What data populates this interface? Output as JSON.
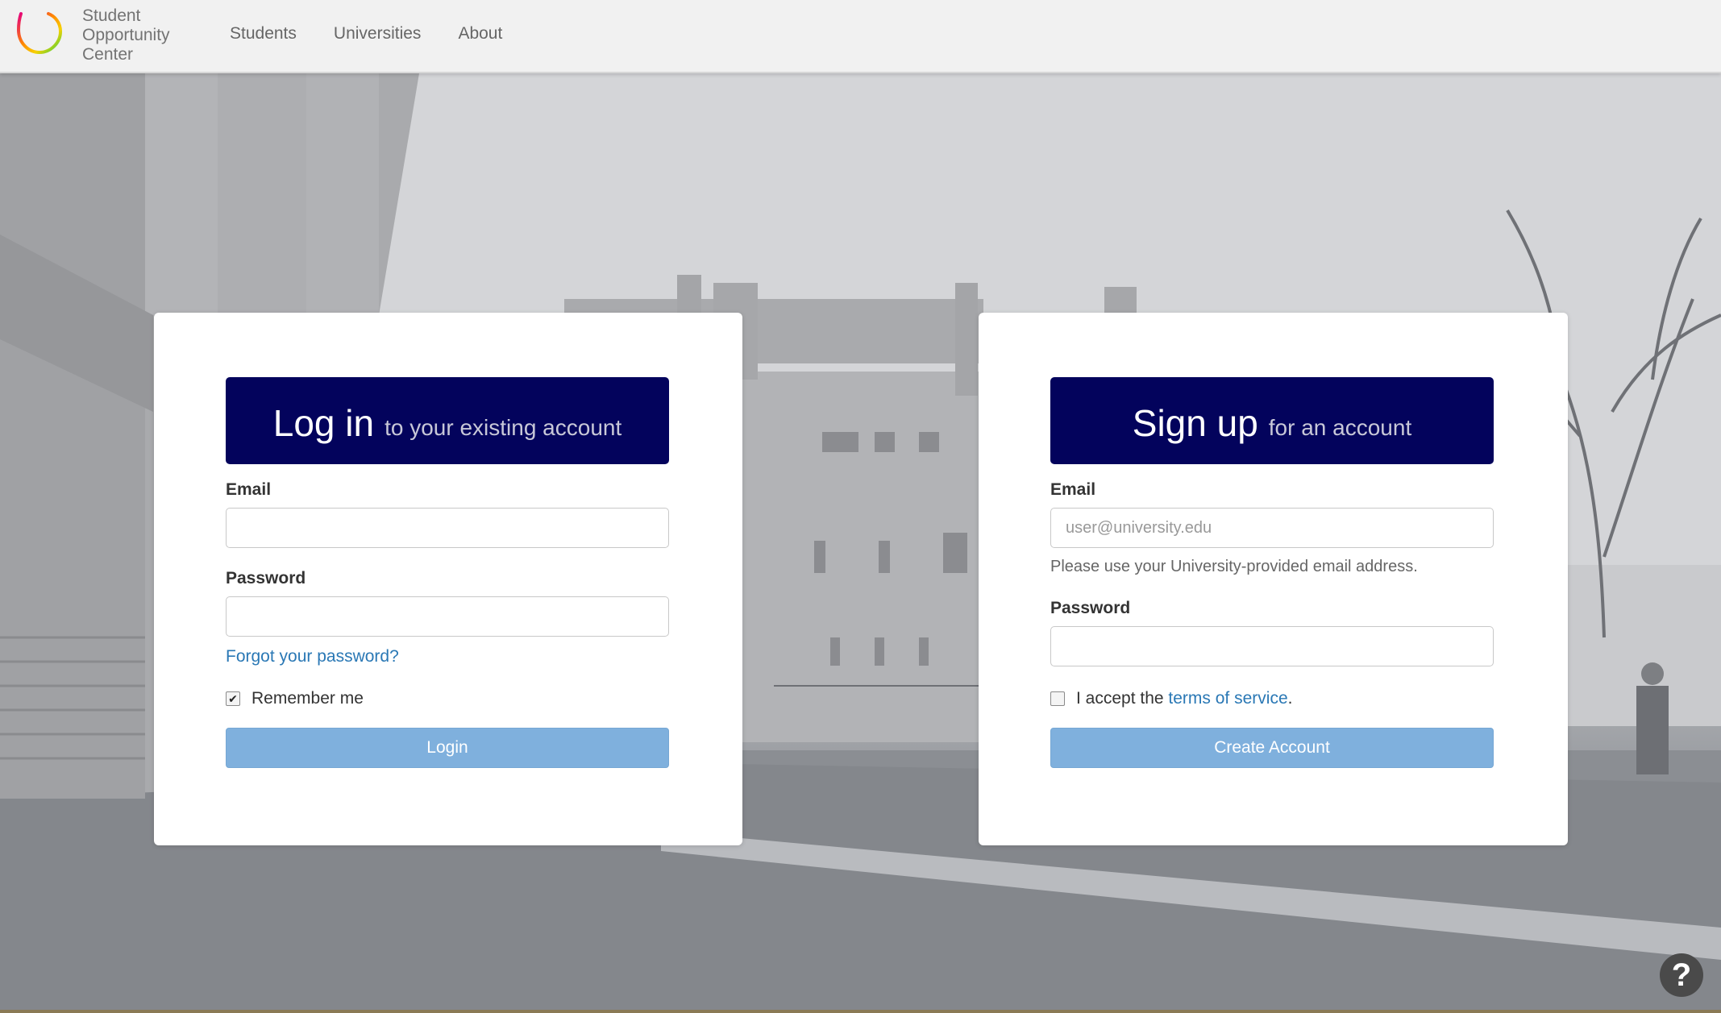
{
  "header": {
    "brand_lines": [
      "Student",
      "Opportunity",
      "Center"
    ],
    "nav": [
      {
        "label": "Students"
      },
      {
        "label": "Universities"
      },
      {
        "label": "About"
      }
    ]
  },
  "login": {
    "title": "Log in",
    "subtitle": "to your existing account",
    "email_label": "Email",
    "email_value": "",
    "password_label": "Password",
    "forgot_link": "Forgot your password?",
    "remember_label": "Remember me",
    "remember_checked": true,
    "button": "Login"
  },
  "signup": {
    "title": "Sign up",
    "subtitle": "for an account",
    "email_label": "Email",
    "email_placeholder": "user@university.edu",
    "email_help": "Please use your University-provided email address.",
    "password_label": "Password",
    "terms_prefix": "I accept the",
    "terms_link": "terms of service",
    "terms_suffix": ".",
    "terms_checked": false,
    "button": "Create Account"
  },
  "help_button": {
    "label": "?"
  },
  "colors": {
    "title_bg": "#03035c",
    "button_bg": "#7fb0dd",
    "link": "#2a78b5",
    "navbar_bg": "#f1f1f1"
  }
}
